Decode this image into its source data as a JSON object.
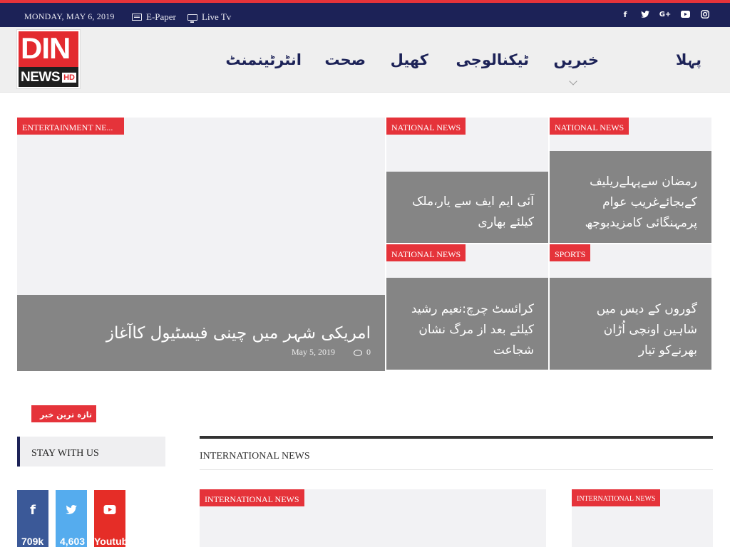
{
  "topbar": {
    "date": "MONDAY, MAY 6, 2019",
    "epaper": "E-Paper",
    "livetv": "Live Tv",
    "social_icons": [
      "facebook-icon",
      "twitter-icon",
      "google-plus-icon",
      "youtube-icon",
      "instagram-icon"
    ]
  },
  "logo": {
    "din": "DIN",
    "news": "NEWS",
    "hd": "HD"
  },
  "nav": {
    "home": "پہلا",
    "news": "خبریں",
    "tech": "ٹیکنالوجی",
    "sports": "کھیل",
    "health": "صحت",
    "entertainment": "انٹرٹینمنٹ"
  },
  "featured": {
    "main": {
      "tag": "ENTERTAINMENT NE...",
      "title": "امریکی شہر میں چینی فیسٹیول کاآغاز",
      "date": "May 5, 2019",
      "comments": "0"
    },
    "card1": {
      "tag": "NATIONAL NEWS",
      "title": "آئی ایم ایف سے یار،ملک کیلئے بھاری"
    },
    "card2": {
      "tag": "NATIONAL NEWS",
      "title": "رمضان سےپہلےریلیف کےبجائےغریب عوام پرمہنگائی کامزیدبوجھ"
    },
    "card3": {
      "tag": "NATIONAL NEWS",
      "title": "کرائسٹ چرچ:نعیم رشید کیلئے بعد از مرگ نشان شجاعت"
    },
    "card4": {
      "tag": "SPORTS",
      "title": "گوروں کے دیس میں شاہین اونچی اُڑان بھرنےکو تیار"
    }
  },
  "latest_label": "تازہ ترین خبر",
  "sidebar": {
    "stay_title": "STAY WITH US",
    "facebook_count": "709k",
    "twitter_count": "4,603",
    "youtube_label": "Youtube"
  },
  "international": {
    "heading": "INTERNATIONAL NEWS",
    "card1_tag": "INTERNATIONAL NEWS",
    "card2_tag": "INTERNATIONAL NEWS"
  },
  "colors": {
    "brand_red": "#e5333a",
    "navy": "#1c2257",
    "facebook": "#3b5998",
    "twitter": "#55acee",
    "youtube": "#e52d27"
  }
}
